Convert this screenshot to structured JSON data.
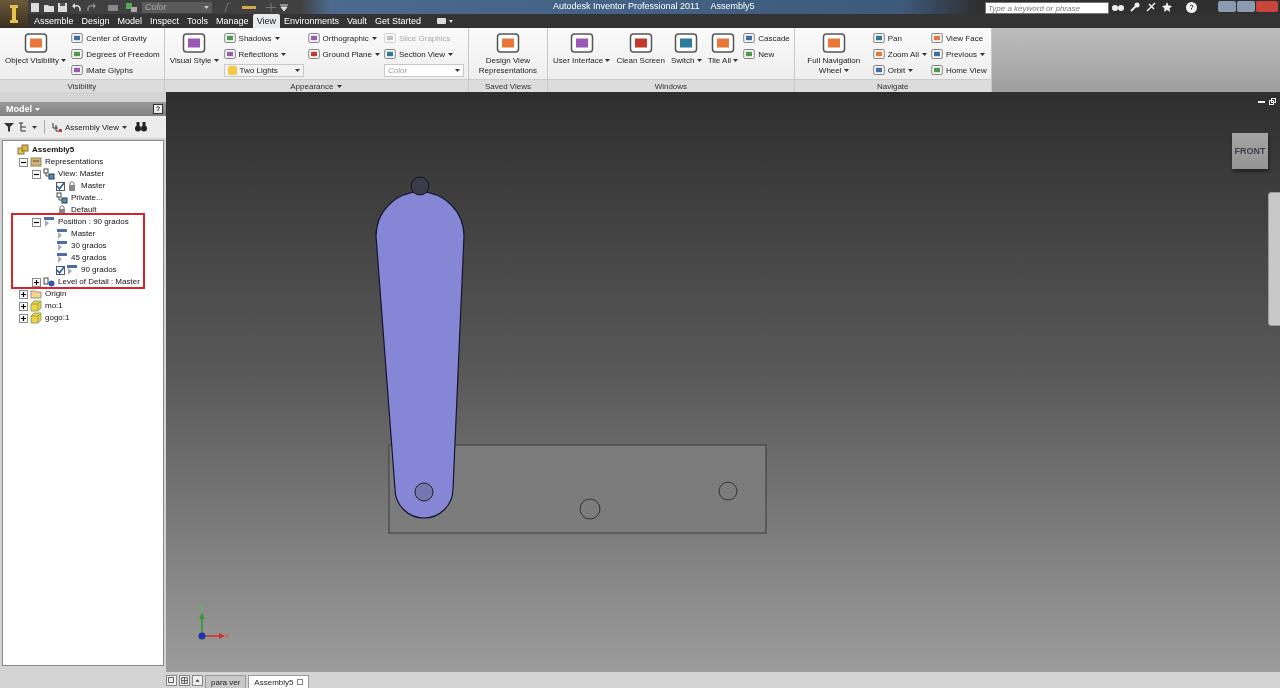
{
  "title_bar": {
    "style_combo": "Color",
    "app_title": "Autodesk Inventor Professional 2011",
    "document": "Assembly5",
    "search": {
      "placeholder": "Type a keyword or phrase"
    }
  },
  "ribbon_tabs": [
    {
      "label": "Assemble",
      "selected": false
    },
    {
      "label": "Design",
      "selected": false
    },
    {
      "label": "Model",
      "selected": false
    },
    {
      "label": "Inspect",
      "selected": false
    },
    {
      "label": "Tools",
      "selected": false
    },
    {
      "label": "Manage",
      "selected": false
    },
    {
      "label": "View",
      "selected": true
    },
    {
      "label": "Environments",
      "selected": false
    },
    {
      "label": "Vault",
      "selected": false
    },
    {
      "label": "Get Started",
      "selected": false
    }
  ],
  "ribbon_panels": [
    {
      "title": "Visibility",
      "menu": false,
      "columns": [
        {
          "kind": "large",
          "label": "Object Visibility",
          "dropdown": true
        },
        {
          "kind": "stack",
          "items": [
            {
              "kind": "small",
              "label": "Center of Gravity",
              "dropdown": false,
              "disabled": false
            },
            {
              "kind": "small",
              "label": "Degrees of Freedom",
              "dropdown": false,
              "disabled": false
            },
            {
              "kind": "small",
              "label": "iMate Glyphs",
              "dropdown": false,
              "disabled": false
            }
          ]
        }
      ]
    },
    {
      "title": "Appearance",
      "menu": true,
      "columns": [
        {
          "kind": "large",
          "label": "Visual Style",
          "dropdown": true
        },
        {
          "kind": "stack",
          "items": [
            {
              "kind": "small",
              "label": "Shadows",
              "dropdown": true,
              "disabled": false
            },
            {
              "kind": "small",
              "label": "Reflections",
              "dropdown": true,
              "disabled": false
            },
            {
              "kind": "combo",
              "value": "Two Lights",
              "disabled": false
            }
          ]
        },
        {
          "kind": "stack",
          "items": [
            {
              "kind": "small",
              "label": "Orthographic",
              "dropdown": true,
              "disabled": false
            },
            {
              "kind": "small",
              "label": "Ground Plane",
              "dropdown": true,
              "disabled": false
            }
          ]
        },
        {
          "kind": "stack",
          "items": [
            {
              "kind": "small",
              "label": "Slice Graphics",
              "dropdown": false,
              "disabled": true
            },
            {
              "kind": "small",
              "label": "Section View",
              "dropdown": true,
              "disabled": false
            },
            {
              "kind": "combo",
              "value": "Color",
              "disabled": true
            }
          ]
        }
      ]
    },
    {
      "title": "Saved Views",
      "menu": false,
      "columns": [
        {
          "kind": "large",
          "label": "Design View Representations",
          "dropdown": false
        }
      ]
    },
    {
      "title": "Windows",
      "menu": false,
      "columns": [
        {
          "kind": "large",
          "label": "User Interface",
          "dropdown": true
        },
        {
          "kind": "large",
          "label": "Clean Screen",
          "dropdown": false
        },
        {
          "kind": "large",
          "label": "Switch",
          "dropdown": true
        },
        {
          "kind": "large",
          "label": "Tile All",
          "dropdown": true
        },
        {
          "kind": "stack",
          "items": [
            {
              "kind": "small",
              "label": "Cascade",
              "dropdown": false,
              "disabled": false
            },
            {
              "kind": "small",
              "label": "New",
              "dropdown": false,
              "disabled": false
            }
          ]
        }
      ]
    },
    {
      "title": "Navigate",
      "menu": false,
      "columns": [
        {
          "kind": "large",
          "label": "Full Navigation Wheel",
          "dropdown": true
        },
        {
          "kind": "stack",
          "items": [
            {
              "kind": "small",
              "label": "Pan",
              "dropdown": false,
              "disabled": false
            },
            {
              "kind": "small",
              "label": "Zoom All",
              "dropdown": true,
              "disabled": false
            },
            {
              "kind": "small",
              "label": "Orbit",
              "dropdown": true,
              "disabled": false
            }
          ]
        },
        {
          "kind": "stack",
          "items": [
            {
              "kind": "small",
              "label": "View Face",
              "dropdown": false,
              "disabled": false
            },
            {
              "kind": "small",
              "label": "Previous",
              "dropdown": true,
              "disabled": false
            },
            {
              "kind": "small",
              "label": "Home View",
              "dropdown": false,
              "disabled": false
            }
          ]
        }
      ]
    }
  ],
  "browser": {
    "title": "Model",
    "view_combo": "Assembly View",
    "highlight": {
      "color": "#d7232b"
    },
    "tree": [
      {
        "label": "Assembly5",
        "kind": "root",
        "children": [
          {
            "label": "Representations",
            "kind": "folder",
            "expanded": true,
            "children": [
              {
                "label": "View: Master",
                "kind": "view",
                "expanded": true,
                "children": [
                  {
                    "label": "Master",
                    "kind": "lock",
                    "checked": true
                  },
                  {
                    "label": "Private...",
                    "kind": "view"
                  },
                  {
                    "label": "Default",
                    "kind": "lock"
                  }
                ]
              },
              {
                "label": "Position : 90 grados",
                "kind": "position",
                "expanded": true,
                "children": [
                  {
                    "label": "Master",
                    "kind": "position"
                  },
                  {
                    "label": "30 grados",
                    "kind": "position"
                  },
                  {
                    "label": "45 grados",
                    "kind": "position"
                  },
                  {
                    "label": "90 grados",
                    "kind": "position",
                    "checked": true
                  }
                ]
              },
              {
                "label": "Level of Detail : Master",
                "kind": "detail",
                "expanded": false
              }
            ]
          },
          {
            "label": "Origin",
            "kind": "origin",
            "expanded": false
          },
          {
            "label": "mo:1",
            "kind": "part",
            "expanded": false
          },
          {
            "label": "gogo:1",
            "kind": "part",
            "expanded": false
          }
        ]
      }
    ]
  },
  "viewport": {
    "view_cube": "FRONT",
    "axes": {
      "x": "x",
      "y": "y"
    }
  },
  "document_tabs": [
    {
      "label": "para ver",
      "selected": false
    },
    {
      "label": "Assembly5",
      "selected": true
    }
  ]
}
